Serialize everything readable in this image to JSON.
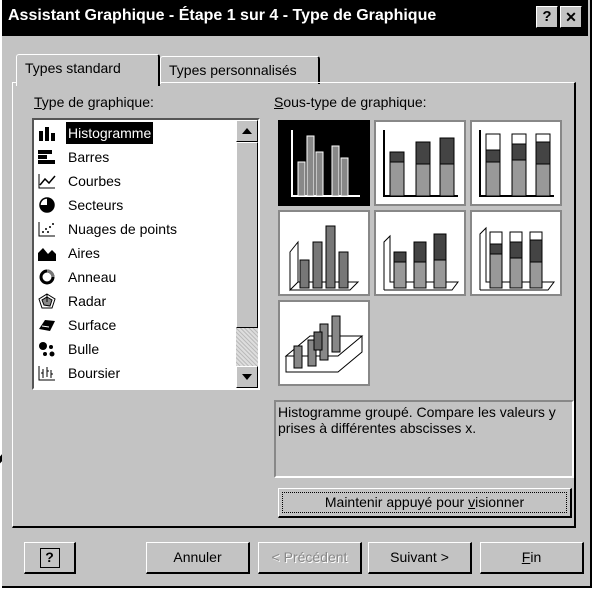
{
  "window": {
    "title": "Assistant Graphique - Étape 1 sur 4 - Type de Graphique",
    "help_label": "?",
    "close_label": "✕"
  },
  "tabs": [
    {
      "label": "Types standard",
      "active": true
    },
    {
      "label": "Types personnalisés",
      "active": false
    }
  ],
  "chart_type": {
    "label_prefix": "T",
    "label_rest": "ype de graphique:",
    "items": [
      {
        "label": "Histogramme",
        "icon": "column-chart-icon",
        "selected": true
      },
      {
        "label": "Barres",
        "icon": "bar-chart-icon"
      },
      {
        "label": "Courbes",
        "icon": "line-chart-icon"
      },
      {
        "label": "Secteurs",
        "icon": "pie-chart-icon"
      },
      {
        "label": "Nuages de points",
        "icon": "scatter-chart-icon"
      },
      {
        "label": "Aires",
        "icon": "area-chart-icon"
      },
      {
        "label": "Anneau",
        "icon": "doughnut-chart-icon"
      },
      {
        "label": "Radar",
        "icon": "radar-chart-icon"
      },
      {
        "label": "Surface",
        "icon": "surface-chart-icon"
      },
      {
        "label": "Bulle",
        "icon": "bubble-chart-icon"
      },
      {
        "label": "Boursier",
        "icon": "stock-chart-icon"
      }
    ]
  },
  "subtype": {
    "label_prefix": "S",
    "label_rest": "ous-type de graphique:",
    "description": "Histogramme groupé. Compare les valeurs y prises à différentes abscisses x."
  },
  "preview_button": {
    "label_before": "Maintenir appuyé pour ",
    "label_underlined": "v",
    "label_after": "isionner"
  },
  "buttons": {
    "help": "?",
    "cancel": "Annuler",
    "previous": "< Précédent",
    "next": "Suivant >",
    "finish_underlined": "F",
    "finish_rest": "in"
  }
}
